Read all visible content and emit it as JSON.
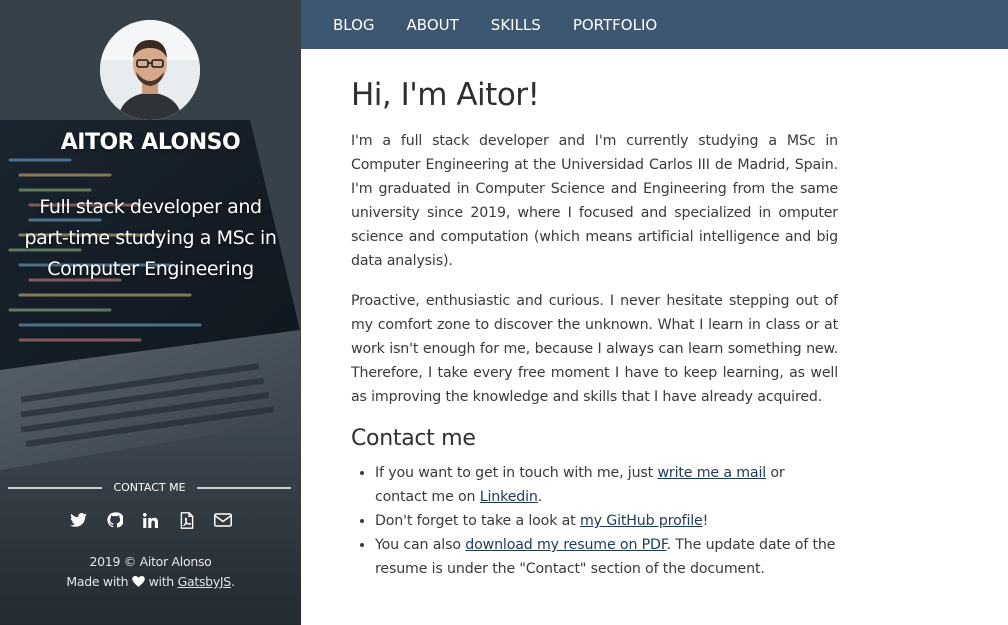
{
  "sidebar": {
    "name": "AITOR ALONSO",
    "tagline": "Full stack developer and part-time studying a MSc in Computer Engineering",
    "contact_label": "CONTACT ME",
    "social_icons": [
      "twitter-icon",
      "github-icon",
      "linkedin-icon",
      "pdf-icon",
      "envelope-icon"
    ],
    "footer_copyright": "2019 © Aitor Alonso",
    "footer_made_prefix": "Made with",
    "footer_with": "with",
    "footer_link": "GatsbyJS",
    "footer_period": "."
  },
  "nav": {
    "items": [
      "BLOG",
      "ABOUT",
      "SKILLS",
      "PORTFOLIO"
    ]
  },
  "main": {
    "title": "Hi, I'm Aitor!",
    "paragraph1": "I'm a full stack developer and I'm currently studying a MSc in Computer Engineering at the Universidad Carlos III de Madrid, Spain. I'm graduated in Computer Science and Engineering from the same university since 2019, where I focused and specialized in omputer science and computation (which means artificial intelligence and big data analysis).",
    "paragraph2": "Proactive, enthusiastic and curious. I never hesitate stepping out of my comfort zone to discover the unknown. What I learn in class or at work isn't enough for me, because I always can learn something new. Therefore, I take every free moment I have to keep learning, as well as improving the knowledge and skills that I have already acquired.",
    "contact_heading": "Contact me",
    "contact_items": [
      {
        "before": "If you want to get in touch with me, just ",
        "link1": "write me a mail",
        "middle": " or contact me on ",
        "link2": "Linkedin",
        "after": "."
      },
      {
        "before": "Don't forget to take a look at ",
        "link1": "my GitHub profile",
        "after": "!"
      },
      {
        "before": "You can also ",
        "link1": "download my resume on PDF",
        "after": ". The update date of the resume is under the \"Contact\" section of the document."
      }
    ]
  },
  "colors": {
    "nav_bg": "#3e5770",
    "link": "#1f3b57"
  }
}
